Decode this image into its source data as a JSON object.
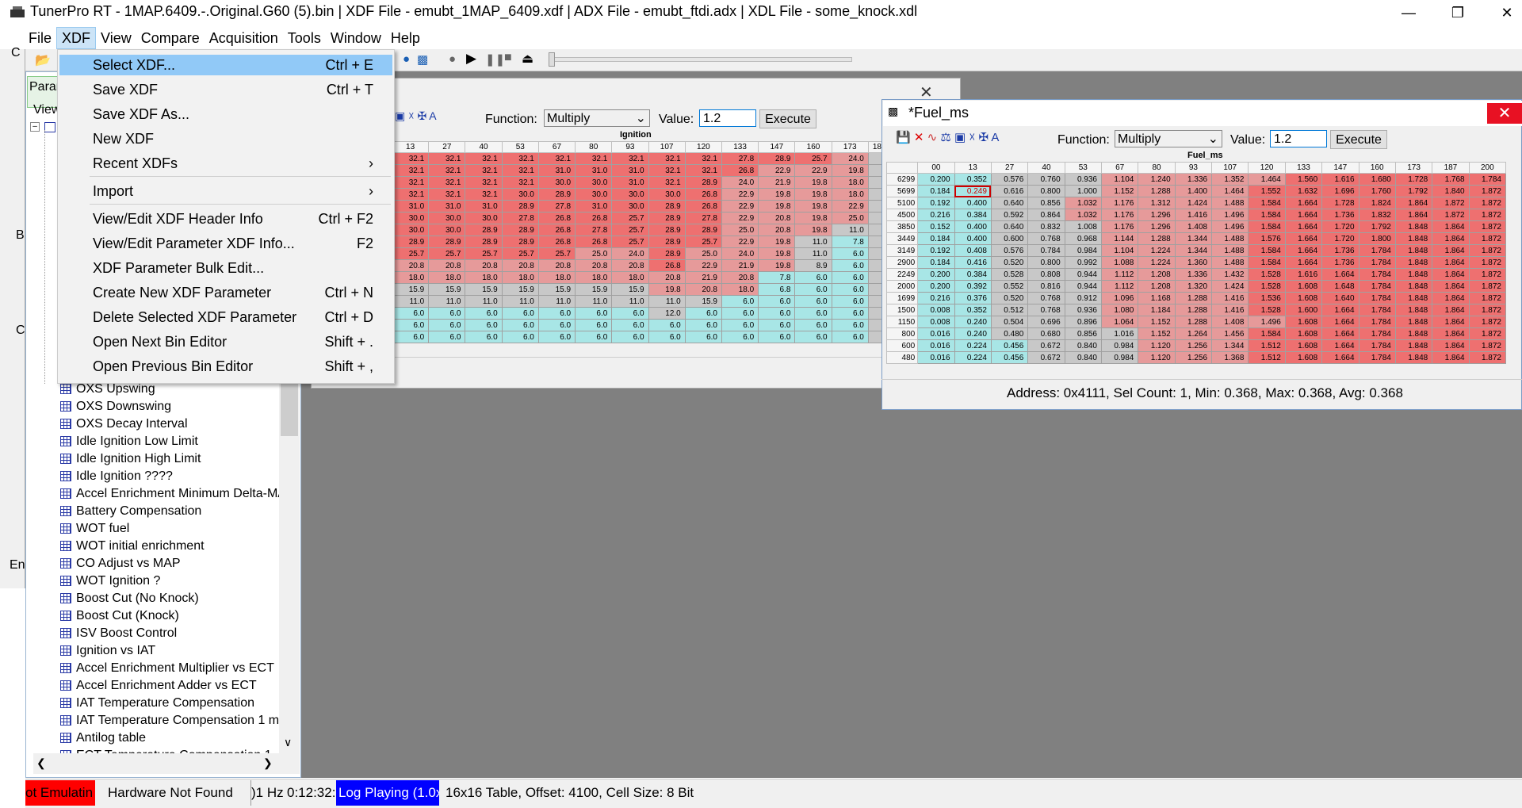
{
  "app": {
    "title": "TunerPro RT - 1MAP.6409.-.Original.G60 (5).bin | XDF File - emubt_1MAP_6409.xdf | ADX File - emubt_ftdi.adx | XDL File - some_knock.xdl"
  },
  "menubar": [
    "File",
    "XDF",
    "View",
    "Compare",
    "Acquisition",
    "Tools",
    "Window",
    "Help"
  ],
  "xdf_menu": [
    {
      "label": "Select XDF...",
      "shortcut": "Ctrl + E"
    },
    {
      "label": "Save XDF",
      "shortcut": "Ctrl + T"
    },
    {
      "label": "Save XDF As...",
      "shortcut": ""
    },
    {
      "label": "New XDF",
      "shortcut": ""
    },
    {
      "label": "Recent XDFs",
      "shortcut": "›"
    },
    {
      "label": "Import",
      "shortcut": "›"
    },
    {
      "label": "View/Edit XDF Header Info",
      "shortcut": "Ctrl + F2"
    },
    {
      "label": "View/Edit Parameter XDF Info...",
      "shortcut": "F2"
    },
    {
      "label": "XDF Parameter Bulk Edit...",
      "shortcut": ""
    },
    {
      "label": "Create New XDF Parameter",
      "shortcut": "Ctrl + N"
    },
    {
      "label": "Delete Selected XDF Parameter",
      "shortcut": "Ctrl + D"
    },
    {
      "label": "Open Next Bin Editor",
      "shortcut": "Shift + ."
    },
    {
      "label": "Open Previous Bin Editor",
      "shortcut": "Shift + ,"
    }
  ],
  "param_panel": {
    "tab": "Param",
    "view": "View",
    "stubs": {
      "c": "C",
      "b": "B",
      "c2": "C",
      "en": "En"
    },
    "items": [
      "OXS Upswing",
      "OXS Downswing",
      "OXS Decay Interval",
      "Idle Ignition Low Limit",
      "Idle Ignition High Limit",
      "Idle Ignition ????",
      "Accel Enrichment Minimum Delta-MAP",
      "Battery Compensation",
      "WOT fuel",
      "WOT initial enrichment",
      "CO Adjust vs MAP",
      "WOT Ignition ?",
      "Boost Cut (No Knock)",
      "Boost Cut (Knock)",
      "ISV Boost Control",
      "Ignition vs IAT",
      "Accel Enrichment Multiplier vs ECT",
      "Accel Enrichment Adder vs ECT",
      "IAT Temperature Compensation",
      "IAT Temperature Compensation 1 map",
      "Antilog table",
      "ECT Temperature Compensation 1"
    ]
  },
  "ign_win": {
    "title": "Ignition",
    "function_label": "Function:",
    "function": "Multiply",
    "value_label": "Value:",
    "value": "1.2",
    "execute": "Execute",
    "cols": [
      "13",
      "27",
      "40",
      "53",
      "67",
      "80",
      "93",
      "107",
      "120",
      "133",
      "147",
      "160",
      "173",
      "18"
    ],
    "rows": [
      [
        "32.1",
        "32.1",
        "32.1",
        "32.1",
        "32.1",
        "32.1",
        "32.1",
        "32.1",
        "32.1",
        "27.8",
        "28.9",
        "25.7",
        "24.0"
      ],
      [
        "32.1",
        "32.1",
        "32.1",
        "32.1",
        "31.0",
        "31.0",
        "31.0",
        "32.1",
        "32.1",
        "26.8",
        "22.9",
        "22.9",
        "19.8"
      ],
      [
        "32.1",
        "32.1",
        "32.1",
        "32.1",
        "30.0",
        "30.0",
        "31.0",
        "32.1",
        "28.9",
        "24.0",
        "21.9",
        "19.8",
        "18.0"
      ],
      [
        "32.1",
        "32.1",
        "32.1",
        "30.0",
        "28.9",
        "30.0",
        "30.0",
        "30.0",
        "26.8",
        "22.9",
        "19.8",
        "19.8",
        "18.0"
      ],
      [
        "31.0",
        "31.0",
        "31.0",
        "28.9",
        "27.8",
        "31.0",
        "30.0",
        "28.9",
        "26.8",
        "22.9",
        "19.8",
        "19.8",
        "22.9"
      ],
      [
        "30.0",
        "30.0",
        "30.0",
        "27.8",
        "26.8",
        "26.8",
        "25.7",
        "28.9",
        "27.8",
        "22.9",
        "20.8",
        "19.8",
        "25.0"
      ],
      [
        "30.0",
        "30.0",
        "28.9",
        "28.9",
        "26.8",
        "27.8",
        "25.7",
        "28.9",
        "28.9",
        "25.0",
        "20.8",
        "19.8",
        "11.0"
      ],
      [
        "28.9",
        "28.9",
        "28.9",
        "28.9",
        "26.8",
        "26.8",
        "25.7",
        "28.9",
        "25.7",
        "22.9",
        "19.8",
        "11.0",
        "7.8"
      ],
      [
        "25.7",
        "25.7",
        "25.7",
        "25.7",
        "25.7",
        "25.0",
        "24.0",
        "28.9",
        "25.0",
        "24.0",
        "19.8",
        "11.0",
        "6.0"
      ],
      [
        "20.8",
        "20.8",
        "20.8",
        "20.8",
        "20.8",
        "20.8",
        "20.8",
        "26.8",
        "22.9",
        "21.9",
        "19.8",
        "8.9",
        "6.0"
      ],
      [
        "18.0",
        "18.0",
        "18.0",
        "18.0",
        "18.0",
        "18.0",
        "18.0",
        "20.8",
        "21.9",
        "20.8",
        "7.8",
        "6.0",
        "6.0"
      ],
      [
        "15.9",
        "15.9",
        "15.9",
        "15.9",
        "15.9",
        "15.9",
        "15.9",
        "19.8",
        "20.8",
        "18.0",
        "6.8",
        "6.0",
        "6.0"
      ],
      [
        "11.0",
        "11.0",
        "11.0",
        "11.0",
        "11.0",
        "11.0",
        "11.0",
        "11.0",
        "15.9",
        "6.0",
        "6.0",
        "6.0",
        "6.0"
      ],
      [
        "6.0",
        "6.0",
        "6.0",
        "6.0",
        "6.0",
        "6.0",
        "6.0",
        "12.0",
        "6.0",
        "6.0",
        "6.0",
        "6.0",
        "6.0"
      ],
      [
        "6.0",
        "6.0",
        "6.0",
        "6.0",
        "6.0",
        "6.0",
        "6.0",
        "6.0",
        "6.0",
        "6.0",
        "6.0",
        "6.0",
        "6.0"
      ],
      [
        "6.0",
        "6.0",
        "6.0",
        "6.0",
        "6.0",
        "6.0",
        "6.0",
        "6.0",
        "6.0",
        "6.0",
        "6.0",
        "6.0",
        "6.0"
      ]
    ]
  },
  "fuel_win": {
    "title": "*Fuel_ms",
    "table_title": "Fuel_ms",
    "function_label": "Function:",
    "function": "Multiply",
    "value_label": "Value:",
    "value": "1.2",
    "execute": "Execute",
    "cols": [
      "00",
      "13",
      "27",
      "40",
      "53",
      "67",
      "80",
      "93",
      "107",
      "120",
      "133",
      "147",
      "160",
      "173",
      "187",
      "200"
    ],
    "row_labels": [
      "6299",
      "5699",
      "5100",
      "4500",
      "3850",
      "3449",
      "3149",
      "2900",
      "2249",
      "2000",
      "1699",
      "1500",
      "1150",
      "800",
      "600",
      "480"
    ],
    "rows": [
      [
        "0.200",
        "0.352",
        "0.576",
        "0.760",
        "0.936",
        "1.104",
        "1.240",
        "1.336",
        "1.352",
        "1.464",
        "1.560",
        "1.616",
        "1.680",
        "1.728",
        "1.768",
        "1.784"
      ],
      [
        "0.184",
        "0.249",
        "0.616",
        "0.800",
        "1.000",
        "1.152",
        "1.288",
        "1.400",
        "1.464",
        "1.552",
        "1.632",
        "1.696",
        "1.760",
        "1.792",
        "1.840",
        "1.872"
      ],
      [
        "0.192",
        "0.400",
        "0.640",
        "0.856",
        "1.032",
        "1.176",
        "1.312",
        "1.424",
        "1.488",
        "1.584",
        "1.664",
        "1.728",
        "1.824",
        "1.864",
        "1.872",
        "1.872"
      ],
      [
        "0.216",
        "0.384",
        "0.592",
        "0.864",
        "1.032",
        "1.176",
        "1.296",
        "1.416",
        "1.496",
        "1.584",
        "1.664",
        "1.736",
        "1.832",
        "1.864",
        "1.872",
        "1.872"
      ],
      [
        "0.152",
        "0.400",
        "0.640",
        "0.832",
        "1.008",
        "1.176",
        "1.296",
        "1.408",
        "1.496",
        "1.584",
        "1.664",
        "1.720",
        "1.792",
        "1.848",
        "1.864",
        "1.872"
      ],
      [
        "0.184",
        "0.400",
        "0.600",
        "0.768",
        "0.968",
        "1.144",
        "1.288",
        "1.344",
        "1.488",
        "1.576",
        "1.664",
        "1.720",
        "1.800",
        "1.848",
        "1.864",
        "1.872"
      ],
      [
        "0.192",
        "0.408",
        "0.576",
        "0.784",
        "0.984",
        "1.104",
        "1.224",
        "1.344",
        "1.488",
        "1.584",
        "1.664",
        "1.736",
        "1.784",
        "1.848",
        "1.864",
        "1.872"
      ],
      [
        "0.184",
        "0.416",
        "0.520",
        "0.800",
        "0.992",
        "1.088",
        "1.224",
        "1.360",
        "1.488",
        "1.584",
        "1.664",
        "1.736",
        "1.784",
        "1.848",
        "1.864",
        "1.872"
      ],
      [
        "0.200",
        "0.384",
        "0.528",
        "0.808",
        "0.944",
        "1.112",
        "1.208",
        "1.336",
        "1.432",
        "1.528",
        "1.616",
        "1.664",
        "1.784",
        "1.848",
        "1.864",
        "1.872"
      ],
      [
        "0.200",
        "0.392",
        "0.552",
        "0.816",
        "0.944",
        "1.112",
        "1.208",
        "1.320",
        "1.424",
        "1.528",
        "1.608",
        "1.648",
        "1.784",
        "1.848",
        "1.864",
        "1.872"
      ],
      [
        "0.216",
        "0.376",
        "0.520",
        "0.768",
        "0.912",
        "1.096",
        "1.168",
        "1.288",
        "1.416",
        "1.536",
        "1.608",
        "1.640",
        "1.784",
        "1.848",
        "1.864",
        "1.872"
      ],
      [
        "0.008",
        "0.352",
        "0.512",
        "0.768",
        "0.936",
        "1.080",
        "1.184",
        "1.288",
        "1.416",
        "1.528",
        "1.600",
        "1.664",
        "1.784",
        "1.848",
        "1.864",
        "1.872"
      ],
      [
        "0.008",
        "0.240",
        "0.504",
        "0.696",
        "0.896",
        "1.064",
        "1.152",
        "1.288",
        "1.408",
        "1.496",
        "1.608",
        "1.664",
        "1.784",
        "1.848",
        "1.864",
        "1.872"
      ],
      [
        "0.016",
        "0.240",
        "0.480",
        "0.680",
        "0.856",
        "1.016",
        "1.152",
        "1.264",
        "1.456",
        "1.584",
        "1.608",
        "1.664",
        "1.784",
        "1.848",
        "1.864",
        "1.872"
      ],
      [
        "0.016",
        "0.224",
        "0.456",
        "0.672",
        "0.840",
        "0.984",
        "1.120",
        "1.256",
        "1.344",
        "1.512",
        "1.608",
        "1.664",
        "1.784",
        "1.848",
        "1.864",
        "1.872"
      ],
      [
        "0.016",
        "0.224",
        "0.456",
        "0.672",
        "0.840",
        "0.984",
        "1.120",
        "1.256",
        "1.368",
        "1.512",
        "1.608",
        "1.664",
        "1.784",
        "1.848",
        "1.864",
        "1.872"
      ]
    ],
    "status": "Address: 0x4111, Sel Count: 1, Min: 0.368, Max: 0.368, Avg: 0.368"
  },
  "statusbar": {
    "emulating": "ot Emulatin",
    "hardware": "Hardware Not Found",
    "hz": ")1 Hz",
    "time": "0:12:32:",
    "log": "Log Playing (1.0x)",
    "table": "16x16 Table, Offset: 4100,  Cell Size: 8 Bit"
  },
  "colors": {
    "low": "#a8e6e6",
    "mid": "#c8c8c8",
    "high": "#e69a9a",
    "highest": "#ee7070",
    "selection": "#91c9f7",
    "accent": "#0000ff"
  }
}
